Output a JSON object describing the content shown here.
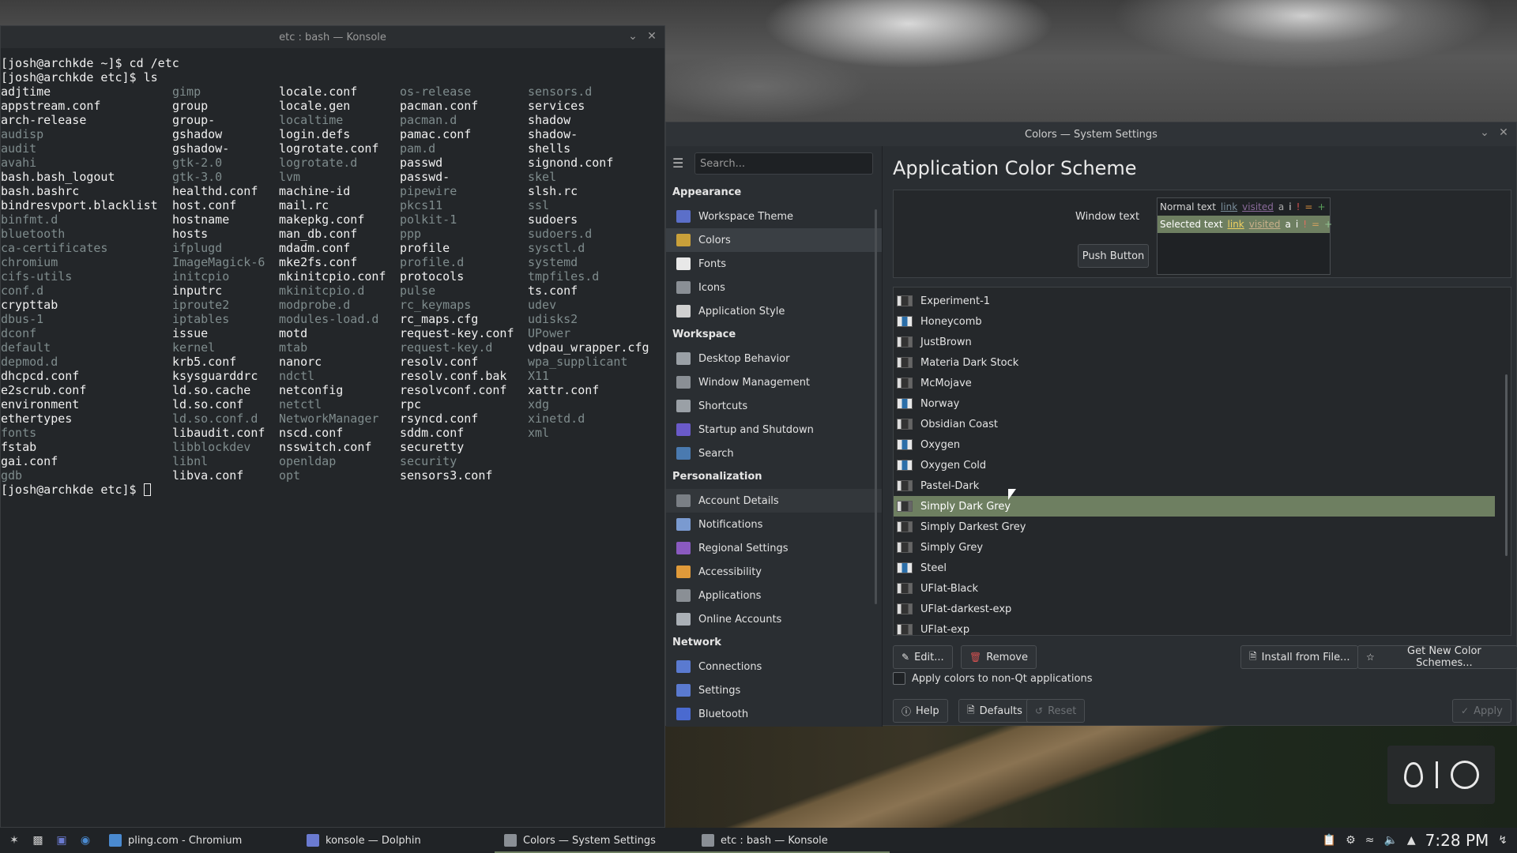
{
  "konsole": {
    "title": "etc : bash — Konsole",
    "prompt1": "[josh@archkde ~]$ cd /etc",
    "prompt2": "[josh@archkde etc]$ ls",
    "prompt3": "[josh@archkde etc]$ ",
    "columns": [
      [
        [
          "adjtime",
          0
        ],
        [
          "appstream.conf",
          0
        ],
        [
          "arch-release",
          0
        ],
        [
          "audisp",
          1
        ],
        [
          "audit",
          1
        ],
        [
          "avahi",
          1
        ],
        [
          "bash.bash_logout",
          0
        ],
        [
          "bash.bashrc",
          0
        ],
        [
          "bindresvport.blacklist",
          0
        ],
        [
          "binfmt.d",
          1
        ],
        [
          "bluetooth",
          1
        ],
        [
          "ca-certificates",
          1
        ],
        [
          "chromium",
          1
        ],
        [
          "cifs-utils",
          1
        ],
        [
          "conf.d",
          1
        ],
        [
          "crypttab",
          0
        ],
        [
          "dbus-1",
          1
        ],
        [
          "dconf",
          1
        ],
        [
          "default",
          1
        ],
        [
          "depmod.d",
          1
        ],
        [
          "dhcpcd.conf",
          0
        ],
        [
          "e2scrub.conf",
          0
        ],
        [
          "environment",
          0
        ],
        [
          "ethertypes",
          0
        ],
        [
          "fonts",
          1
        ],
        [
          "fstab",
          0
        ],
        [
          "gai.conf",
          0
        ],
        [
          "gdb",
          1
        ]
      ],
      [
        [
          "gimp",
          1
        ],
        [
          "group",
          0
        ],
        [
          "group-",
          0
        ],
        [
          "gshadow",
          0
        ],
        [
          "gshadow-",
          0
        ],
        [
          "gtk-2.0",
          1
        ],
        [
          "gtk-3.0",
          1
        ],
        [
          "healthd.conf",
          0
        ],
        [
          "host.conf",
          0
        ],
        [
          "hostname",
          0
        ],
        [
          "hosts",
          0
        ],
        [
          "ifplugd",
          1
        ],
        [
          "ImageMagick-6",
          1
        ],
        [
          "initcpio",
          1
        ],
        [
          "inputrc",
          0
        ],
        [
          "iproute2",
          1
        ],
        [
          "iptables",
          1
        ],
        [
          "issue",
          0
        ],
        [
          "kernel",
          1
        ],
        [
          "krb5.conf",
          0
        ],
        [
          "ksysguarddrc",
          0
        ],
        [
          "ld.so.cache",
          0
        ],
        [
          "ld.so.conf",
          0
        ],
        [
          "ld.so.conf.d",
          1
        ],
        [
          "libaudit.conf",
          0
        ],
        [
          "libblockdev",
          1
        ],
        [
          "libnl",
          1
        ],
        [
          "libva.conf",
          0
        ]
      ],
      [
        [
          "locale.conf",
          0
        ],
        [
          "locale.gen",
          0
        ],
        [
          "localtime",
          1
        ],
        [
          "login.defs",
          0
        ],
        [
          "logrotate.conf",
          0
        ],
        [
          "logrotate.d",
          1
        ],
        [
          "lvm",
          1
        ],
        [
          "machine-id",
          0
        ],
        [
          "mail.rc",
          0
        ],
        [
          "makepkg.conf",
          0
        ],
        [
          "man_db.conf",
          0
        ],
        [
          "mdadm.conf",
          0
        ],
        [
          "mke2fs.conf",
          0
        ],
        [
          "mkinitcpio.conf",
          0
        ],
        [
          "mkinitcpio.d",
          1
        ],
        [
          "modprobe.d",
          1
        ],
        [
          "modules-load.d",
          1
        ],
        [
          "motd",
          0
        ],
        [
          "mtab",
          1
        ],
        [
          "nanorc",
          0
        ],
        [
          "ndctl",
          1
        ],
        [
          "netconfig",
          0
        ],
        [
          "netctl",
          1
        ],
        [
          "NetworkManager",
          1
        ],
        [
          "nscd.conf",
          0
        ],
        [
          "nsswitch.conf",
          0
        ],
        [
          "openldap",
          1
        ],
        [
          "opt",
          1
        ]
      ],
      [
        [
          "os-release",
          1
        ],
        [
          "pacman.conf",
          0
        ],
        [
          "pacman.d",
          1
        ],
        [
          "pamac.conf",
          0
        ],
        [
          "pam.d",
          1
        ],
        [
          "passwd",
          0
        ],
        [
          "passwd-",
          0
        ],
        [
          "pipewire",
          1
        ],
        [
          "pkcs11",
          1
        ],
        [
          "polkit-1",
          1
        ],
        [
          "ppp",
          1
        ],
        [
          "profile",
          0
        ],
        [
          "profile.d",
          1
        ],
        [
          "protocols",
          0
        ],
        [
          "pulse",
          1
        ],
        [
          "rc_keymaps",
          1
        ],
        [
          "rc_maps.cfg",
          0
        ],
        [
          "request-key.conf",
          0
        ],
        [
          "request-key.d",
          1
        ],
        [
          "resolv.conf",
          0
        ],
        [
          "resolv.conf.bak",
          0
        ],
        [
          "resolvconf.conf",
          0
        ],
        [
          "rpc",
          0
        ],
        [
          "rsyncd.conf",
          0
        ],
        [
          "sddm.conf",
          0
        ],
        [
          "securetty",
          0
        ],
        [
          "security",
          1
        ],
        [
          "sensors3.conf",
          0
        ]
      ],
      [
        [
          "sensors.d",
          1
        ],
        [
          "services",
          0
        ],
        [
          "shadow",
          0
        ],
        [
          "shadow-",
          0
        ],
        [
          "shells",
          0
        ],
        [
          "signond.conf",
          0
        ],
        [
          "skel",
          1
        ],
        [
          "slsh.rc",
          0
        ],
        [
          "ssl",
          1
        ],
        [
          "sudoers",
          0
        ],
        [
          "sudoers.d",
          1
        ],
        [
          "sysctl.d",
          1
        ],
        [
          "systemd",
          1
        ],
        [
          "tmpfiles.d",
          1
        ],
        [
          "ts.conf",
          0
        ],
        [
          "udev",
          1
        ],
        [
          "udisks2",
          1
        ],
        [
          "UPower",
          1
        ],
        [
          "vdpau_wrapper.cfg",
          0
        ],
        [
          "wpa_supplicant",
          1
        ],
        [
          "X11",
          1
        ],
        [
          "xattr.conf",
          0
        ],
        [
          "xdg",
          1
        ],
        [
          "xinetd.d",
          1
        ],
        [
          "xml",
          1
        ]
      ]
    ]
  },
  "settings": {
    "title": "Colors — System Settings",
    "search_placeholder": "Search...",
    "sections": [
      {
        "header": "Appearance",
        "items": [
          {
            "label": "Workspace Theme",
            "icon": "workspace-theme-icon",
            "color": "#5b6fc9"
          },
          {
            "label": "Colors",
            "icon": "colors-icon",
            "color": "#c9a03a",
            "active": true
          },
          {
            "label": "Fonts",
            "icon": "fonts-icon",
            "color": "#e8e8e8"
          },
          {
            "label": "Icons",
            "icon": "icons-icon",
            "color": "#8a8f95"
          },
          {
            "label": "Application Style",
            "icon": "application-style-icon",
            "color": "#d0d0d0"
          }
        ]
      },
      {
        "header": "Workspace",
        "items": [
          {
            "label": "Desktop Behavior",
            "icon": "desktop-behavior-icon",
            "color": "#9aa0a6"
          },
          {
            "label": "Window Management",
            "icon": "window-management-icon",
            "color": "#8a8f95"
          },
          {
            "label": "Shortcuts",
            "icon": "shortcuts-icon",
            "color": "#9aa0a6"
          },
          {
            "label": "Startup and Shutdown",
            "icon": "startup-shutdown-icon",
            "color": "#6a5ac9"
          },
          {
            "label": "Search",
            "icon": "search-icon",
            "color": "#4a7ab0"
          }
        ]
      },
      {
        "header": "Personalization",
        "items": [
          {
            "label": "Account Details",
            "icon": "account-details-icon",
            "color": "#7a7f85",
            "hover": true
          },
          {
            "label": "Notifications",
            "icon": "notifications-icon",
            "color": "#7a9ad0"
          },
          {
            "label": "Regional Settings",
            "icon": "regional-settings-icon",
            "color": "#8a5ac0"
          },
          {
            "label": "Accessibility",
            "icon": "accessibility-icon",
            "color": "#e09a3a"
          },
          {
            "label": "Applications",
            "icon": "applications-icon",
            "color": "#8a8f95"
          },
          {
            "label": "Online Accounts",
            "icon": "online-accounts-icon",
            "color": "#aab0b6"
          }
        ]
      },
      {
        "header": "Network",
        "items": [
          {
            "label": "Connections",
            "icon": "connections-icon",
            "color": "#5a7ad0"
          },
          {
            "label": "Settings",
            "icon": "network-settings-icon",
            "color": "#5a7ad0"
          },
          {
            "label": "Bluetooth",
            "icon": "bluetooth-icon",
            "color": "#4a6ad0"
          }
        ]
      }
    ],
    "page_title": "Application Color Scheme",
    "preview": {
      "window_text": "Window text",
      "push_button": "Push Button",
      "normal_text": "Normal text",
      "selected_text": "Selected text",
      "link": "link",
      "visited": "visited",
      "marks": [
        "a",
        "i",
        "!",
        "=",
        "+"
      ]
    },
    "schemes": [
      {
        "name": "Experiment-1",
        "dark": true
      },
      {
        "name": "Honeycomb",
        "dark": false
      },
      {
        "name": "JustBrown",
        "dark": true
      },
      {
        "name": "Materia Dark Stock",
        "dark": true
      },
      {
        "name": "McMojave",
        "dark": true
      },
      {
        "name": "Norway",
        "dark": false
      },
      {
        "name": "Obsidian Coast",
        "dark": true
      },
      {
        "name": "Oxygen",
        "dark": false
      },
      {
        "name": "Oxygen Cold",
        "dark": false
      },
      {
        "name": "Pastel-Dark",
        "dark": true
      },
      {
        "name": "Simply Dark Grey",
        "dark": true,
        "selected": true
      },
      {
        "name": "Simply Darkest Grey",
        "dark": true
      },
      {
        "name": "Simply Grey",
        "dark": true
      },
      {
        "name": "Steel",
        "dark": false
      },
      {
        "name": "UFlat-Black",
        "dark": true
      },
      {
        "name": "UFlat-darkest-exp",
        "dark": true
      },
      {
        "name": "UFlat-exp",
        "dark": true
      }
    ],
    "buttons": {
      "edit": "Edit...",
      "remove": "Remove",
      "install": "Install from File...",
      "get_new": "Get New Color Schemes...",
      "help": "Help",
      "defaults": "Defaults",
      "reset": "Reset",
      "apply": "Apply"
    },
    "apply_non_qt": "Apply colors to non-Qt applications",
    "accent": "#6e7f61"
  },
  "taskbar": {
    "tasks": [
      {
        "label": "pling.com - Chromium",
        "icon": "chromium-icon"
      },
      {
        "label": "konsole — Dolphin",
        "icon": "dolphin-icon"
      },
      {
        "label": "Colors — System Settings",
        "icon": "system-settings-icon",
        "active": true
      },
      {
        "label": "etc : bash — Konsole",
        "icon": "konsole-icon",
        "active": true
      }
    ],
    "clock": "7:28 PM"
  }
}
